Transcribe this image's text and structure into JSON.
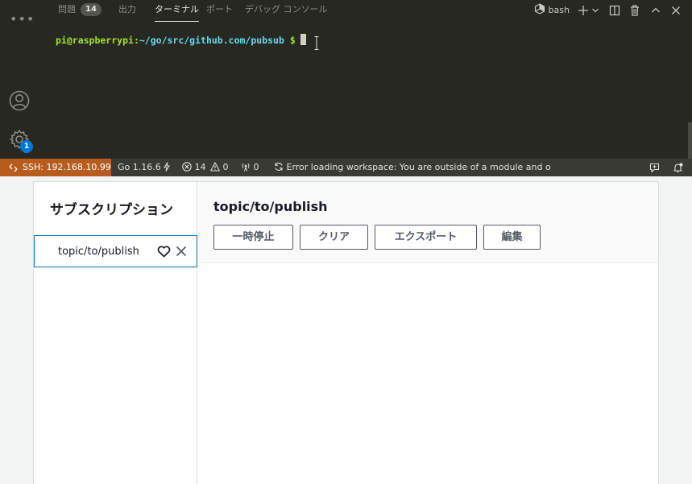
{
  "vscode": {
    "activity": {
      "more_icon": "ellipsis-icon",
      "account_icon": "account-icon",
      "settings_icon": "gear-icon",
      "settings_badge": "1"
    },
    "panel_tabs": [
      {
        "label": "問題",
        "badge": "14",
        "active": false
      },
      {
        "label": "出力",
        "active": false
      },
      {
        "label": "ターミナル",
        "active": true
      },
      {
        "label": "ポート",
        "active": false
      },
      {
        "label": "デバッグ コンソール",
        "active": false
      }
    ],
    "terminal_toolbar": {
      "shell_label": "bash",
      "icons": [
        "bash-shell-icon",
        "plus-icon",
        "chevron-down-icon",
        "split-icon",
        "trash-icon",
        "chevron-up-icon",
        "close-icon"
      ]
    },
    "terminal": {
      "user_host": "pi@raspberrypi",
      "colon": ":",
      "path": "~/go/src/github.com/pubsub",
      "dollar": "$"
    },
    "statusbar": {
      "remote": "SSH: 192.168.10.99",
      "go_version": "Go 1.16.6",
      "errors": "14",
      "warnings": "0",
      "ports": "0",
      "message": "Error loading workspace: You are outside of a module and o"
    }
  },
  "app": {
    "sidebar": {
      "title": "サブスクリプション",
      "items": [
        {
          "label": "topic/to/publish"
        }
      ]
    },
    "main": {
      "title": "topic/to/publish",
      "buttons": {
        "pause": "一時停止",
        "clear": "クリア",
        "export": "エクスポート",
        "edit": "編集"
      }
    }
  },
  "colors": {
    "terminal_bg": "#272822",
    "remote_indicator": "#b85c1e",
    "prompt_green": "#a6e22e",
    "prompt_cyan": "#66d9ef",
    "selected_border": "#0073bb"
  }
}
